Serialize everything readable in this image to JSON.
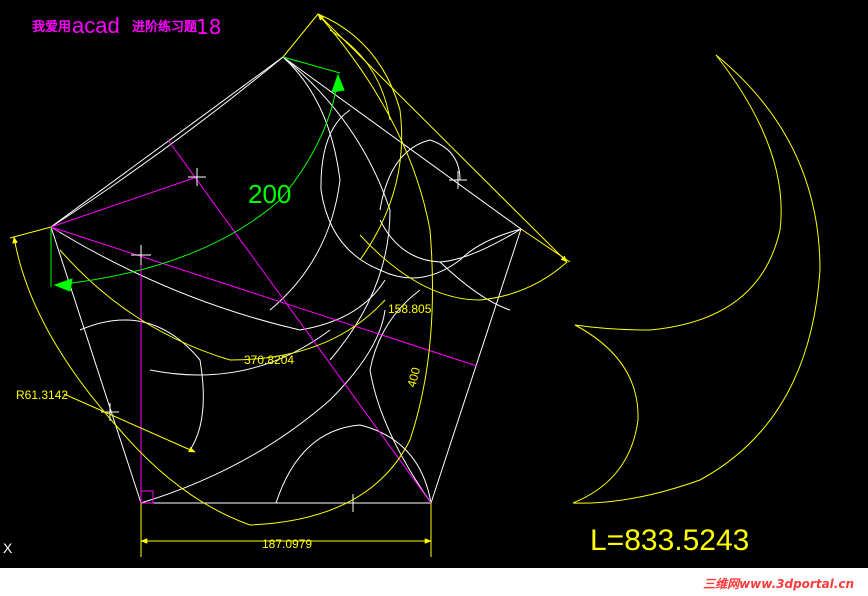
{
  "title": {
    "prefix": "我爱用",
    "app": "acad",
    "suffix": "进阶练习题",
    "number": "18"
  },
  "dimensions": {
    "arc_length": "200",
    "chord_a": "158.805",
    "chord_b": "370.8204",
    "radius": "R61.3142",
    "arc_label": "400",
    "base": "187.0979"
  },
  "result": "L=833.5243",
  "axis_marker": "X",
  "watermark": "三维网www.3dportal.cn",
  "colors": {
    "outline": "#ffffff",
    "dimension": "#ffff00",
    "construction": "#ff00ff",
    "highlight": "#00ff00",
    "title": "#ff00ff"
  }
}
